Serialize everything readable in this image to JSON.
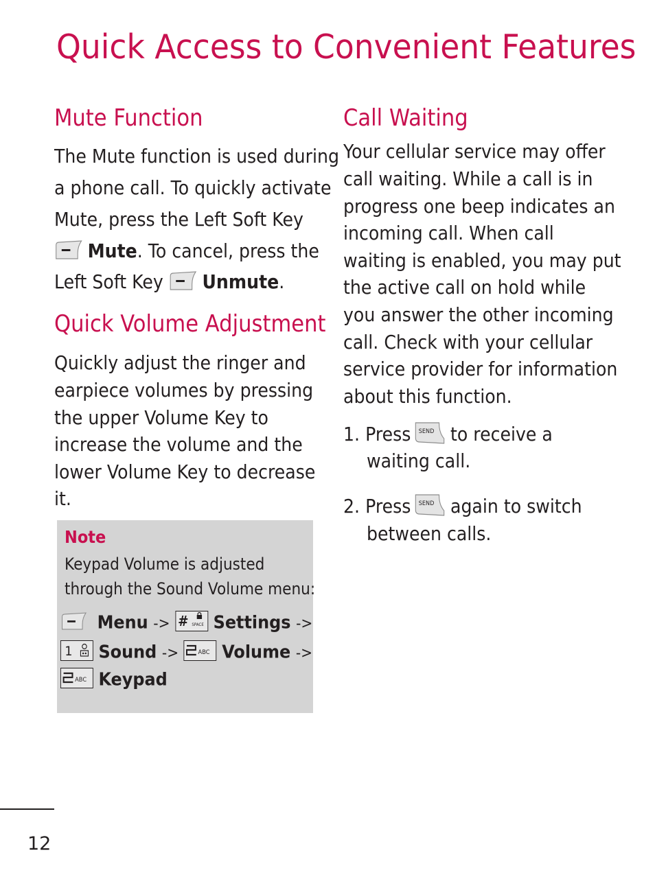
{
  "page": {
    "title": "Quick Access to Convenient Features",
    "page_number": "12",
    "accent_color": "#c8104f",
    "note_background": "#d4d4d4"
  },
  "mute": {
    "heading": "Mute Function",
    "lines": [
      "The Mute function is used during",
      "a phone call. To quickly activate",
      "Mute, press the Left Soft Key"
    ],
    "line4_bold": "Mute",
    "line4_rest": ". To cancel, press the",
    "line5_text": "Left Soft Key",
    "line5_bold": "Unmute",
    "line5_end": ".",
    "softkey_icon": "left-soft-key-icon"
  },
  "volume": {
    "heading": "Quick Volume Adjustment",
    "lines": [
      "Quickly adjust the ringer and",
      "earpiece volumes by pressing",
      "the upper Volume Key to",
      "increase the volume and the",
      "lower Volume Key to decrease",
      "it."
    ]
  },
  "note": {
    "title": "Note",
    "lines": [
      "Keypad Volume is adjusted",
      "through the Sound Volume menu:"
    ],
    "path": {
      "menu": "Menu",
      "settings": "Settings",
      "sound": "Sound",
      "volume": "Volume",
      "keypad": "Keypad",
      "arrow": "->"
    },
    "keys": {
      "hash_sub": "SPACE",
      "one_main": "1",
      "two_main": "2",
      "two_sub": "ABC"
    }
  },
  "call_waiting": {
    "heading": "Call Waiting",
    "lines": [
      "Your cellular service may offer",
      "call waiting. While a call is in",
      "progress one beep indicates an",
      "incoming call. When call",
      "waiting is enabled, you may put",
      "the active call on hold while",
      "you answer the other incoming",
      "call. Check with your cellular",
      "service provider for information",
      "about this function."
    ],
    "steps": [
      {
        "num": "1.",
        "before": "Press",
        "after": "to receive a",
        "cont": "waiting call."
      },
      {
        "num": "2.",
        "before": "Press",
        "after": "again to switch",
        "cont": "between calls."
      }
    ],
    "send_key_label": "SEND"
  }
}
